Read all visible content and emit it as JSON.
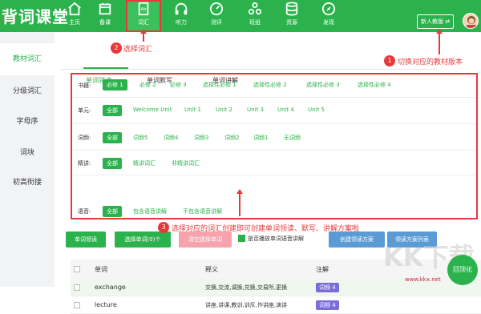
{
  "app": {
    "logo_text": "背词课堂"
  },
  "nav": [
    {
      "label": "主页",
      "icon": "home-icon"
    },
    {
      "label": "备课",
      "icon": "calendar-icon"
    },
    {
      "label": "词汇",
      "icon": "book-icon"
    },
    {
      "label": "听力",
      "icon": "headphones-icon"
    },
    {
      "label": "测评",
      "icon": "gauge-icon"
    },
    {
      "label": "班组",
      "icon": "group-icon"
    },
    {
      "label": "资源",
      "icon": "database-icon"
    },
    {
      "label": "发现",
      "icon": "compass-icon"
    }
  ],
  "header": {
    "edition_label": "新人教版 ⇄"
  },
  "sidebar": {
    "items": [
      "教材词汇",
      "分级词汇",
      "字母序",
      "词块",
      "初高衔接"
    ]
  },
  "tabs": [
    "单词领读",
    "单词默写",
    "单词讲解"
  ],
  "filters": {
    "book": {
      "label": "书籍:",
      "options": [
        "必修 1",
        "必修 2",
        "必修 3",
        "选择性必修 1",
        "选择性必修 2",
        "选择性必修 3",
        "选择性必修 4"
      ]
    },
    "unit": {
      "label": "单元:",
      "options": [
        "全部",
        "Welcome Unit",
        "Unit 1",
        "Unit 2",
        "Unit 3",
        "Unit 4",
        "Unit 5"
      ]
    },
    "frequency": {
      "label": "词频:",
      "options": [
        "全部",
        "词频5",
        "词频4",
        "词频3",
        "词频2",
        "词频1",
        "无词频"
      ]
    },
    "explain": {
      "label": "精讲:",
      "options": [
        "全部",
        "精讲词汇",
        "非精讲词汇"
      ]
    },
    "audio": {
      "label": "语音:",
      "options": [
        "全部",
        "包含语音讲解",
        "不包含语音讲解"
      ]
    }
  },
  "actions": {
    "lead_read": "单词领读",
    "select_words": "选择单词(0)个",
    "clear_selection": "清空选择单词",
    "autoplay_label": "是否播放单词语音讲解",
    "create_plan": "创建领读方案",
    "plan_list": "领读方案列表"
  },
  "table": {
    "headers": [
      "单词",
      "释义",
      "注解"
    ],
    "rows": [
      {
        "word": "exchange",
        "meaning": "交换,交流,调换,兑换,交易所,更换",
        "note": "词频 4"
      },
      {
        "word": "lecture",
        "meaning": "讲座,讲课,教训,训斥,作讲座,演讲",
        "note": "词频 4"
      }
    ]
  },
  "annotations": {
    "a1": {
      "num": "1",
      "text": "切换对应的教材版本"
    },
    "a2": {
      "num": "2",
      "text": "选择词汇"
    },
    "a3": {
      "num": "3",
      "text": "选择对应的词汇创建即可创建单词领读、默写、讲解方案啦"
    }
  },
  "fab_label": "回顶化",
  "watermark": {
    "text": "KK下载",
    "url": "www.kkx.net"
  },
  "colors": {
    "brand": "#2bb24c",
    "annotation": "#e63a3a",
    "badge": "#7a6dd8"
  }
}
